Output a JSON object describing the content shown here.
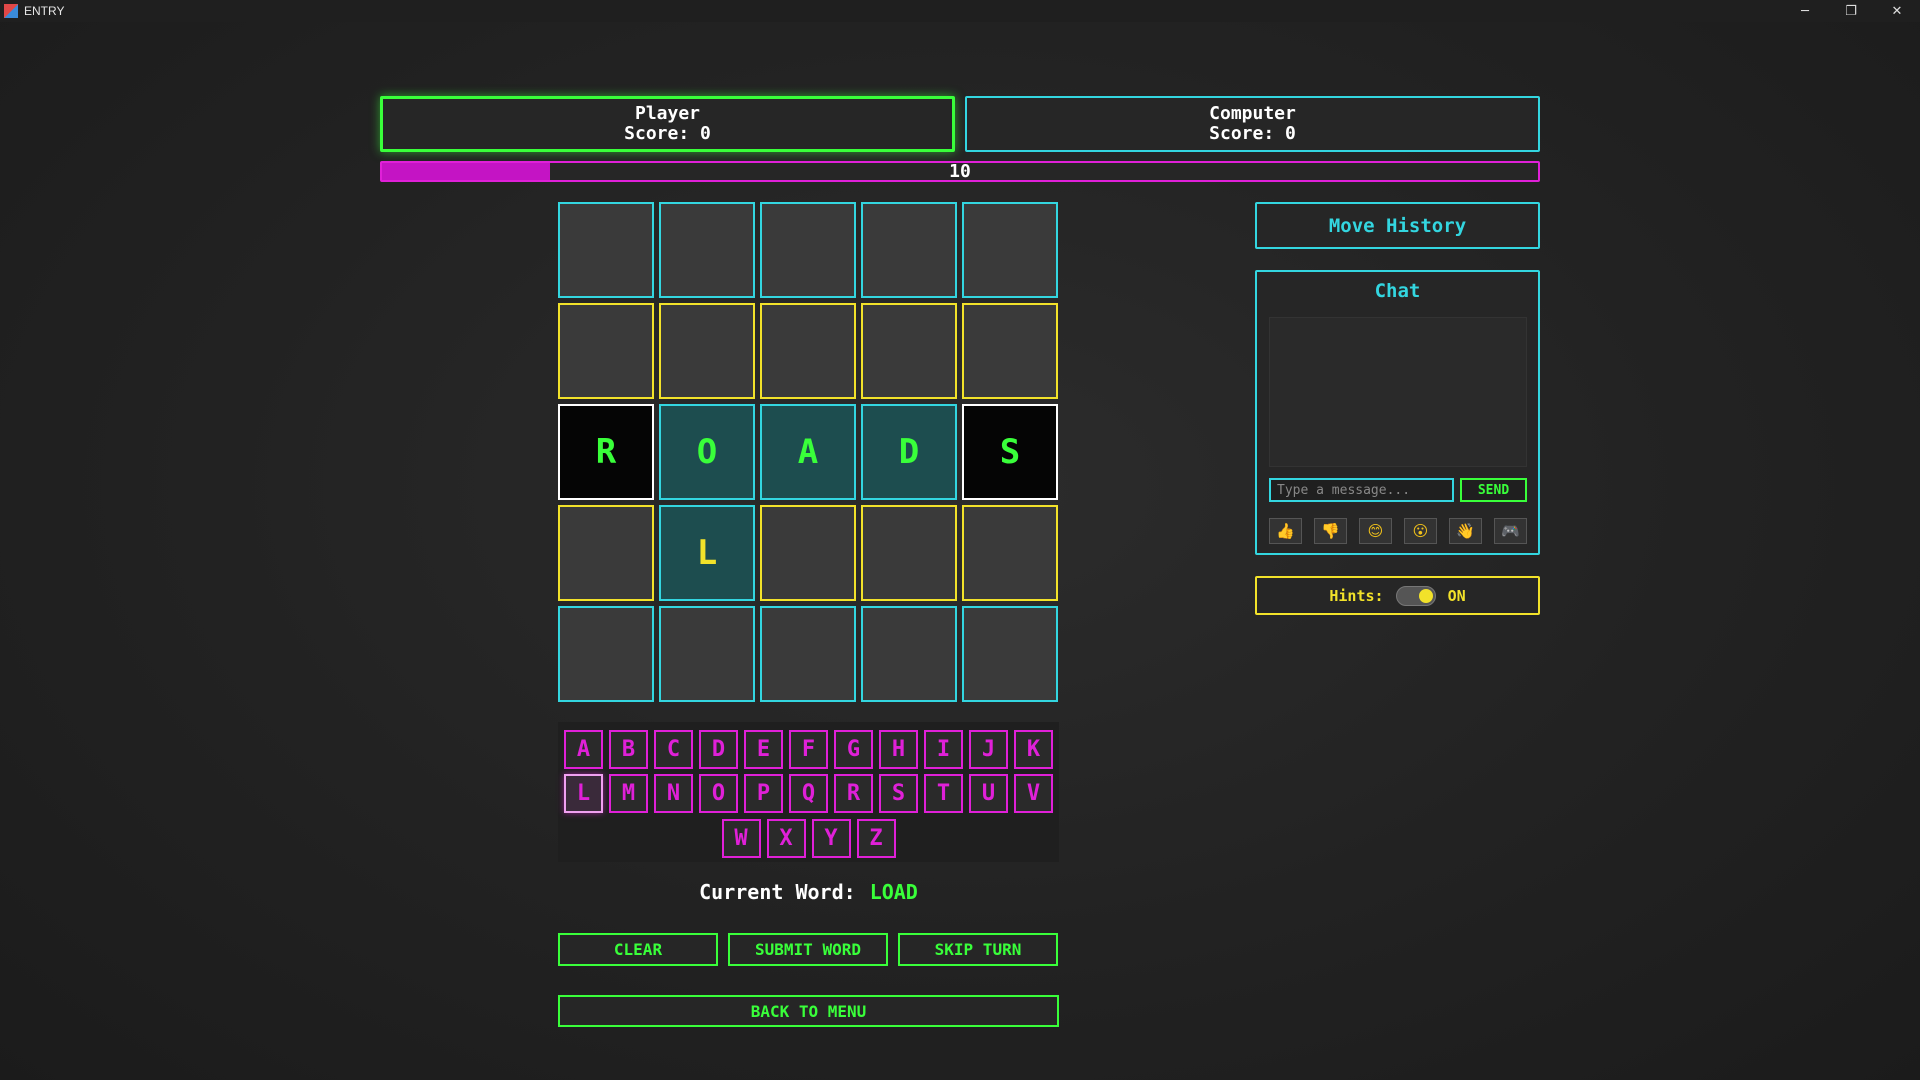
{
  "window": {
    "title": "ENTRY",
    "controls": {
      "minimize": "─",
      "maximize": "❐",
      "close": "✕"
    }
  },
  "scoreboard": {
    "player": {
      "name": "Player",
      "score_text": "Score: 0"
    },
    "computer": {
      "name": "Computer",
      "score_text": "Score: 0"
    },
    "active": "player"
  },
  "timer": {
    "value": "10",
    "fill_fraction": 0.145,
    "color": "#e020d8"
  },
  "board": {
    "rows": [
      [
        {
          "letter": "",
          "border": "cyan",
          "fill": "gray"
        },
        {
          "letter": "",
          "border": "cyan",
          "fill": "gray"
        },
        {
          "letter": "",
          "border": "cyan",
          "fill": "gray"
        },
        {
          "letter": "",
          "border": "cyan",
          "fill": "gray"
        },
        {
          "letter": "",
          "border": "cyan",
          "fill": "gray"
        }
      ],
      [
        {
          "letter": "",
          "border": "yellow",
          "fill": "gray"
        },
        {
          "letter": "",
          "border": "yellow",
          "fill": "gray"
        },
        {
          "letter": "",
          "border": "yellow",
          "fill": "gray"
        },
        {
          "letter": "",
          "border": "yellow",
          "fill": "gray"
        },
        {
          "letter": "",
          "border": "yellow",
          "fill": "gray"
        }
      ],
      [
        {
          "letter": "R",
          "border": "white",
          "fill": "black"
        },
        {
          "letter": "O",
          "border": "cyan",
          "fill": "teal"
        },
        {
          "letter": "A",
          "border": "cyan",
          "fill": "teal"
        },
        {
          "letter": "D",
          "border": "cyan",
          "fill": "teal"
        },
        {
          "letter": "S",
          "border": "white",
          "fill": "black"
        }
      ],
      [
        {
          "letter": "",
          "border": "yellow",
          "fill": "gray"
        },
        {
          "letter": "L",
          "border": "cyan",
          "fill": "teal",
          "new": true
        },
        {
          "letter": "",
          "border": "yellow",
          "fill": "gray"
        },
        {
          "letter": "",
          "border": "yellow",
          "fill": "gray"
        },
        {
          "letter": "",
          "border": "yellow",
          "fill": "gray"
        }
      ],
      [
        {
          "letter": "",
          "border": "cyan",
          "fill": "gray"
        },
        {
          "letter": "",
          "border": "cyan",
          "fill": "gray"
        },
        {
          "letter": "",
          "border": "cyan",
          "fill": "gray"
        },
        {
          "letter": "",
          "border": "cyan",
          "fill": "gray"
        },
        {
          "letter": "",
          "border": "cyan",
          "fill": "gray"
        }
      ]
    ]
  },
  "keyboard": {
    "rows": [
      [
        "A",
        "B",
        "C",
        "D",
        "E",
        "F",
        "G",
        "H",
        "I",
        "J",
        "K"
      ],
      [
        "L",
        "M",
        "N",
        "O",
        "P",
        "Q",
        "R",
        "S",
        "T",
        "U",
        "V"
      ],
      [
        "W",
        "X",
        "Y",
        "Z"
      ]
    ],
    "selected": "L"
  },
  "current_word": {
    "label": "Current Word:",
    "value": "LOAD"
  },
  "actions": {
    "clear": "CLEAR",
    "submit": "SUBMIT WORD",
    "skip": "SKIP TURN",
    "menu": "BACK TO MENU"
  },
  "move_history": {
    "title": "Move History"
  },
  "chat": {
    "title": "Chat",
    "input_placeholder": "Type a message...",
    "send_label": "SEND",
    "reactions": [
      {
        "icon": "thumbs-up-icon",
        "glyph": "👍"
      },
      {
        "icon": "thumbs-down-icon",
        "glyph": "👎"
      },
      {
        "icon": "smile-icon",
        "glyph": "😊"
      },
      {
        "icon": "surprised-icon",
        "glyph": "😮"
      },
      {
        "icon": "wave-icon",
        "glyph": "👋"
      },
      {
        "icon": "gamepad-icon",
        "glyph": "🎮"
      }
    ]
  },
  "hints": {
    "label": "Hints:",
    "state": "ON",
    "enabled": true
  },
  "colors": {
    "green": "#39ff3a",
    "cyan": "#33d6e0",
    "yellow": "#f2e22a",
    "magenta": "#e020d8"
  }
}
